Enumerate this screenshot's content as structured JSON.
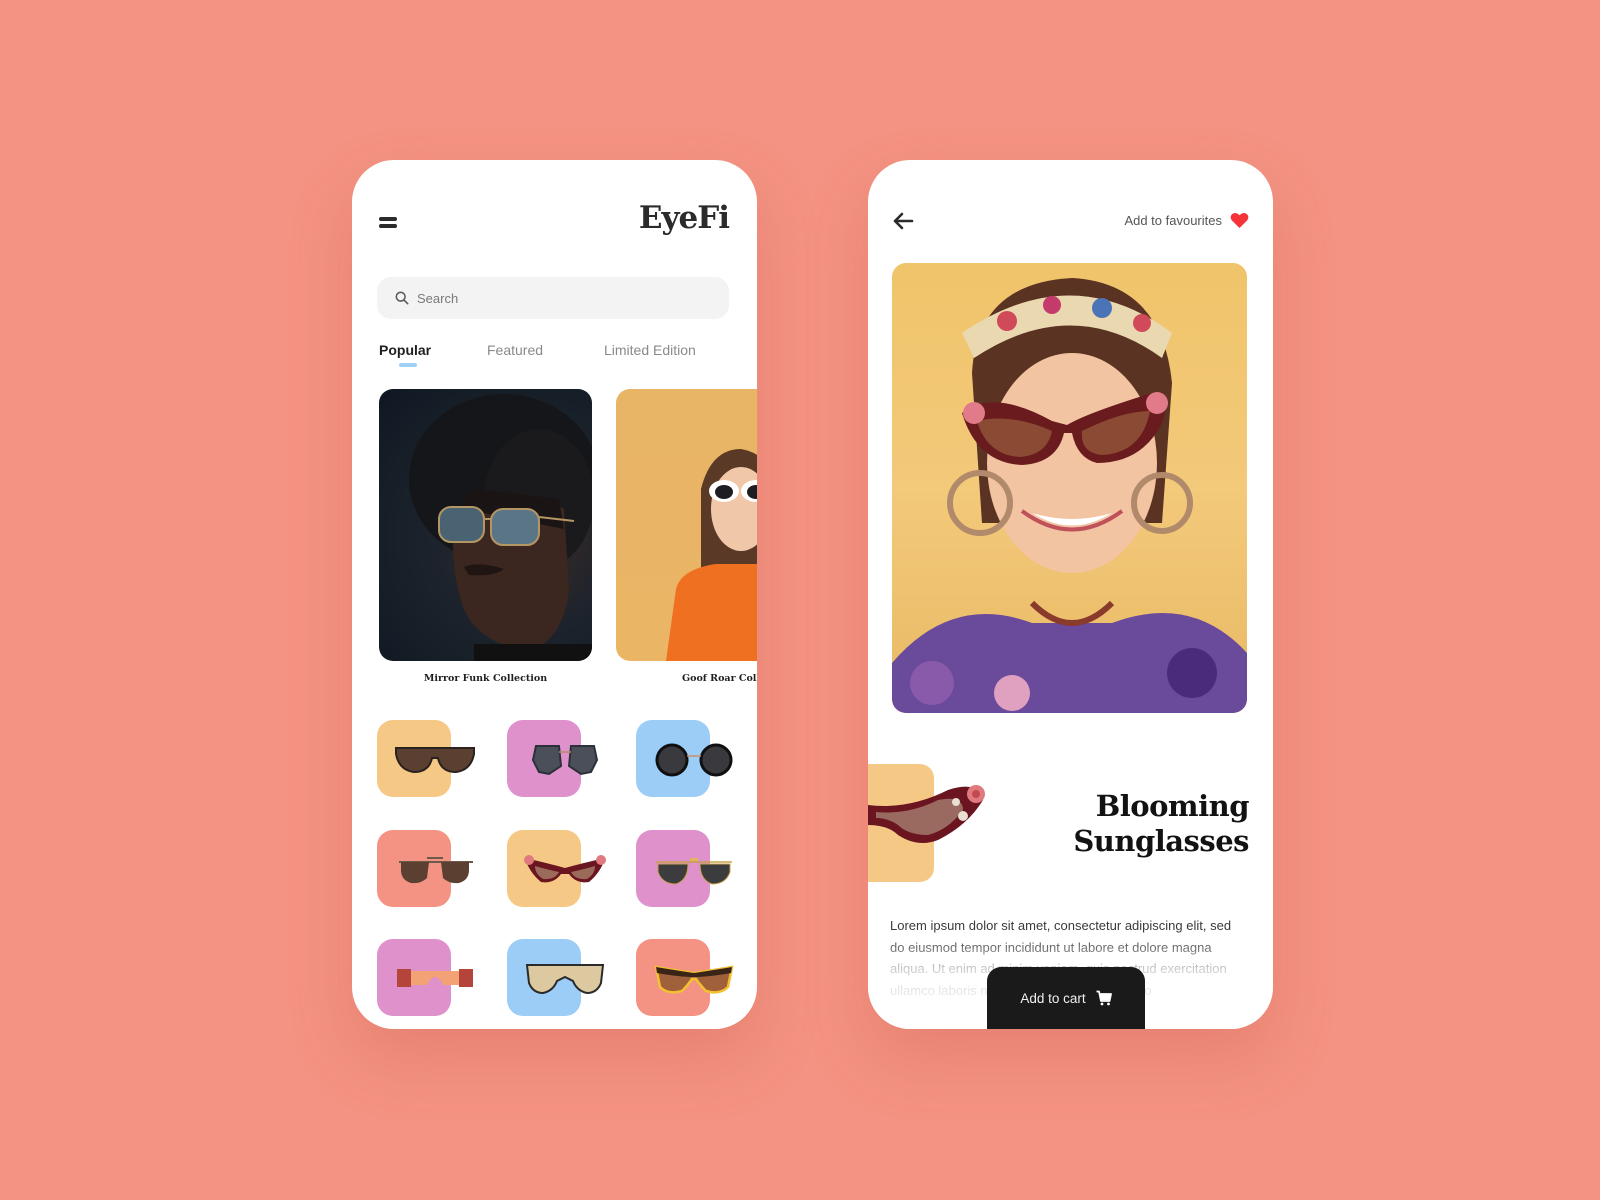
{
  "background_color": "#f49383",
  "left_screen": {
    "brand": "EyeFi",
    "search": {
      "placeholder": "Search",
      "value": ""
    },
    "tabs": [
      {
        "label": "Popular",
        "active": true
      },
      {
        "label": "Featured",
        "active": false
      },
      {
        "label": "Limited Edition",
        "active": false
      }
    ],
    "tab_indicator_color": "#9fd0f8",
    "collections": [
      {
        "title": "Mirror Funk Collection",
        "image": "man-with-mirrored-aviator-sunglasses"
      },
      {
        "title": "Goof Roar Collection",
        "image": "woman-with-white-round-sunglasses"
      }
    ],
    "products": [
      {
        "name": "square-brown-sunglasses",
        "tile_color": "#f5c985"
      },
      {
        "name": "oversized-grey-sunglasses",
        "tile_color": "#df91cc"
      },
      {
        "name": "round-black-sunglasses",
        "tile_color": "#9ccdf7"
      },
      {
        "name": "navigator-brown-sunglasses",
        "tile_color": "#f49383"
      },
      {
        "name": "blooming-cat-eye-sunglasses",
        "tile_color": "#f5c985"
      },
      {
        "name": "aviator-grey-sunglasses",
        "tile_color": "#df91cc"
      },
      {
        "name": "orange-shield-sunglasses",
        "tile_color": "#df91cc"
      },
      {
        "name": "gold-mirror-shield-sunglasses",
        "tile_color": "#9ccdf7"
      },
      {
        "name": "tortoise-yellow-cat-eye-sunglasses",
        "tile_color": "#f49383"
      }
    ]
  },
  "right_screen": {
    "favourite_label": "Add to favourites",
    "favourite_color": "#f4333a",
    "hero_image": "woman-wearing-floral-cat-eye-sunglasses",
    "product_title_line1": "Blooming",
    "product_title_line2": "Sunglasses",
    "product_tile_color": "#f5c985",
    "description": "Lorem ipsum dolor sit amet, consectetur adipiscing elit, sed do eiusmod tempor incididunt ut labore et dolore magna aliqua. Ut enim ad minim veniam, quis nostrud exercitation ullamco laboris nisi ut aliquip ex ea commodo",
    "cart_label": "Add to cart"
  }
}
